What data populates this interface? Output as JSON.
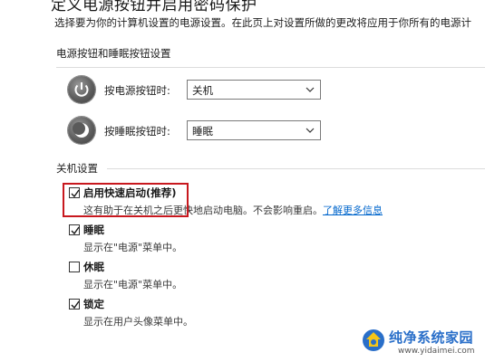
{
  "header": {
    "title": "定义电源按钮并启用密码保护",
    "description": "选择要为你的计算机设置的电源设置。在此页上对设置所做的更改将应用于你所有的电源计"
  },
  "power_buttons": {
    "group_title": "电源按钮和睡眠按钮设置",
    "power_button": {
      "label": "按电源按钮时:",
      "value": "关机",
      "icon": "power-icon"
    },
    "sleep_button": {
      "label": "按睡眠按钮时:",
      "value": "睡眠",
      "icon": "sleep-moon-icon"
    }
  },
  "shutdown": {
    "group_title": "关机设置",
    "options": [
      {
        "label": "启用快速启动(推荐)",
        "checked": true,
        "desc": "这有助于在关机之后更快地启动电脑。不会影响重启。",
        "link": "了解更多信息"
      },
      {
        "label": "睡眠",
        "checked": true,
        "desc": "显示在\"电源\"菜单中。"
      },
      {
        "label": "休眠",
        "checked": false,
        "desc": "显示在\"电源\"菜单中。"
      },
      {
        "label": "锁定",
        "checked": true,
        "desc": "显示在用户头像菜单中。"
      }
    ]
  },
  "colors": {
    "highlight": "#c8181e",
    "link": "#0066cc"
  },
  "watermark": {
    "name": "纯净系统家园",
    "url": "www.yidaimei.com"
  }
}
